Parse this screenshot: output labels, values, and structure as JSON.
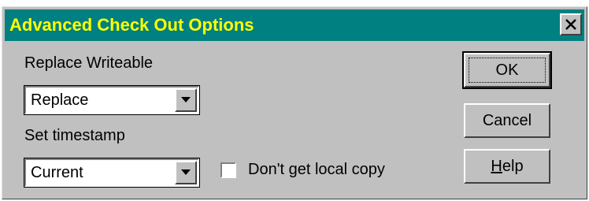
{
  "window": {
    "title": "Advanced Check Out Options",
    "close_glyph": "✕"
  },
  "replace_writeable": {
    "label": "Replace Writeable",
    "value": "Replace"
  },
  "set_timestamp": {
    "label": "Set timestamp",
    "value": "Current"
  },
  "local_copy": {
    "label": "Don't get local copy",
    "checked": false
  },
  "buttons": {
    "ok": "OK",
    "cancel": "Cancel",
    "help_mnemonic": "H",
    "help_rest": "elp"
  },
  "icons": {
    "dropdown": "chevron-down-icon",
    "close": "close-icon"
  },
  "colors": {
    "titlebar": "#008080",
    "title_text": "#ffff00",
    "face": "#c0c0c0"
  }
}
